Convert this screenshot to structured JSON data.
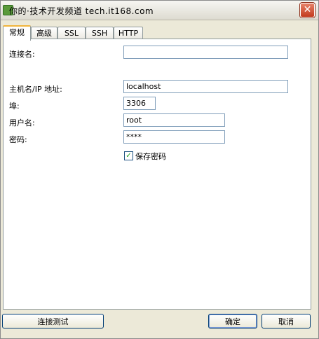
{
  "titlebar": {
    "watermark": "你的·技术开发频道 tech.it168.com",
    "close_symbol": "✕"
  },
  "tabs": [
    {
      "label": "常规",
      "active": true
    },
    {
      "label": "高级",
      "active": false
    },
    {
      "label": "SSL",
      "active": false
    },
    {
      "label": "SSH",
      "active": false
    },
    {
      "label": "HTTP",
      "active": false
    }
  ],
  "form": {
    "connection_name_label": "连接名:",
    "connection_name_value": "",
    "host_label": "主机名/IP 地址:",
    "host_value": "localhost",
    "port_label": "埠:",
    "port_value": "3306",
    "user_label": "用户名:",
    "user_value": "root",
    "password_label": "密码:",
    "password_value": "****",
    "save_password_label": "保存密码",
    "save_password_checked": true,
    "check_symbol": "✓"
  },
  "buttons": {
    "test_label": "连接测试",
    "ok_label": "确定",
    "cancel_label": "取消"
  },
  "icons": {
    "app": "app-icon",
    "close": "close-icon",
    "check": "checkbox-check-icon"
  }
}
